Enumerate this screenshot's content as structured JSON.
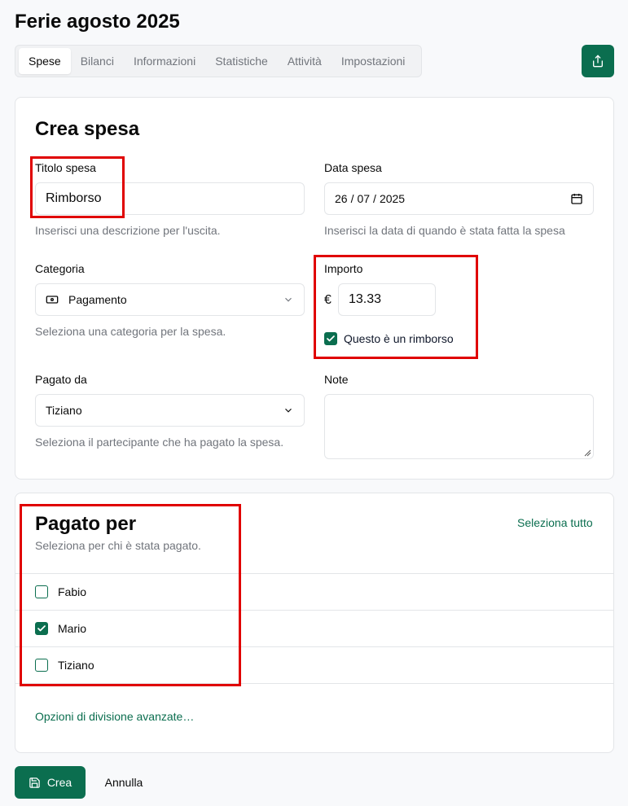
{
  "page": {
    "title": "Ferie agosto 2025"
  },
  "tabs": [
    "Spese",
    "Bilanci",
    "Informazioni",
    "Statistiche",
    "Attività",
    "Impostazioni"
  ],
  "active_tab": "Spese",
  "icons": {
    "share": "share-icon",
    "category": "banknote-icon",
    "calendar": "calendar-icon",
    "save": "save-icon"
  },
  "colors": {
    "accent": "#0b6e4f",
    "highlight": "#e00000"
  },
  "form": {
    "title": "Crea spesa",
    "expense_title": {
      "label": "Titolo spesa",
      "value": "Rimborso",
      "help": "Inserisci una descrizione per l'uscita."
    },
    "expense_date": {
      "label": "Data spesa",
      "day": "26",
      "month": "07",
      "year": "2025",
      "sep": "/",
      "help": "Inserisci la data di quando è stata fatta la spesa"
    },
    "category": {
      "label": "Categoria",
      "value": "Pagamento",
      "help": "Seleziona una categoria per la spesa."
    },
    "amount": {
      "label": "Importo",
      "currency": "€",
      "value": "13.33",
      "refund_label": "Questo è un rimborso",
      "refund_checked": true
    },
    "paid_by": {
      "label": "Pagato da",
      "value": "Tiziano",
      "help": "Seleziona il partecipante che ha pagato la spesa."
    },
    "notes": {
      "label": "Note",
      "value": ""
    }
  },
  "paid_for": {
    "title": "Pagato per",
    "subtitle": "Seleziona per chi è stata pagato.",
    "select_all": "Seleziona tutto",
    "participants": [
      {
        "name": "Fabio",
        "checked": false
      },
      {
        "name": "Mario",
        "checked": true
      },
      {
        "name": "Tiziano",
        "checked": false
      }
    ],
    "advanced": "Opzioni di divisione avanzate…"
  },
  "actions": {
    "create": "Crea",
    "cancel": "Annulla"
  }
}
